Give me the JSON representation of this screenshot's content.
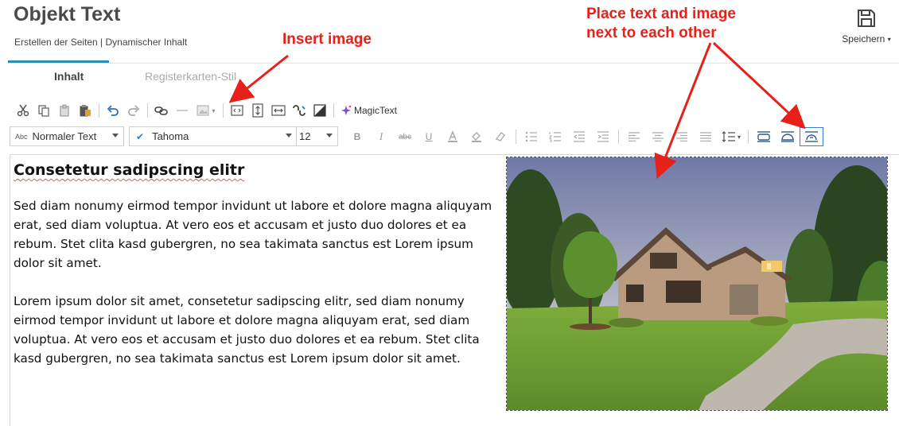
{
  "header": {
    "title": "Objekt Text",
    "breadcrumb": "Erstellen der Seiten | Dynamischer Inhalt",
    "save_label": "Speichern"
  },
  "tabs": [
    {
      "label": "Inhalt",
      "active": true
    },
    {
      "label": "Registerkarten-Stil",
      "active": false
    }
  ],
  "toolbar": {
    "magictext_label": "MagicText",
    "paragraph_style": "Normaler Text",
    "paragraph_style_icon": "Abc",
    "font_family": "Tahoma",
    "font_size": "12"
  },
  "content": {
    "heading": "Consetetur sadipscing elitr",
    "paragraph1": "Sed diam nonumy eirmod tempor invidunt ut labore et dolore magna aliquyam erat, sed diam voluptua. At vero eos et accusam et justo duo dolores et ea rebum. Stet clita kasd gubergren, no sea takimata sanctus est Lorem ipsum dolor sit amet.",
    "paragraph2": "Lorem ipsum dolor sit amet, consetetur sadipscing elitr, sed diam nonumy eirmod tempor invidunt ut labore et dolore magna aliquyam erat, sed diam voluptua. At vero eos et accusam et justo duo dolores et ea rebum. Stet clita kasd gubergren, no sea takimata sanctus est Lorem ipsum dolor sit amet."
  },
  "annotations": {
    "insert_image": "Insert image",
    "place_line1": "Place text and image",
    "place_line2": "next to each other"
  },
  "colors": {
    "accent": "#2b8fb3",
    "annotation": "#e8201a",
    "active_wrap_border": "#3a7bd5"
  }
}
